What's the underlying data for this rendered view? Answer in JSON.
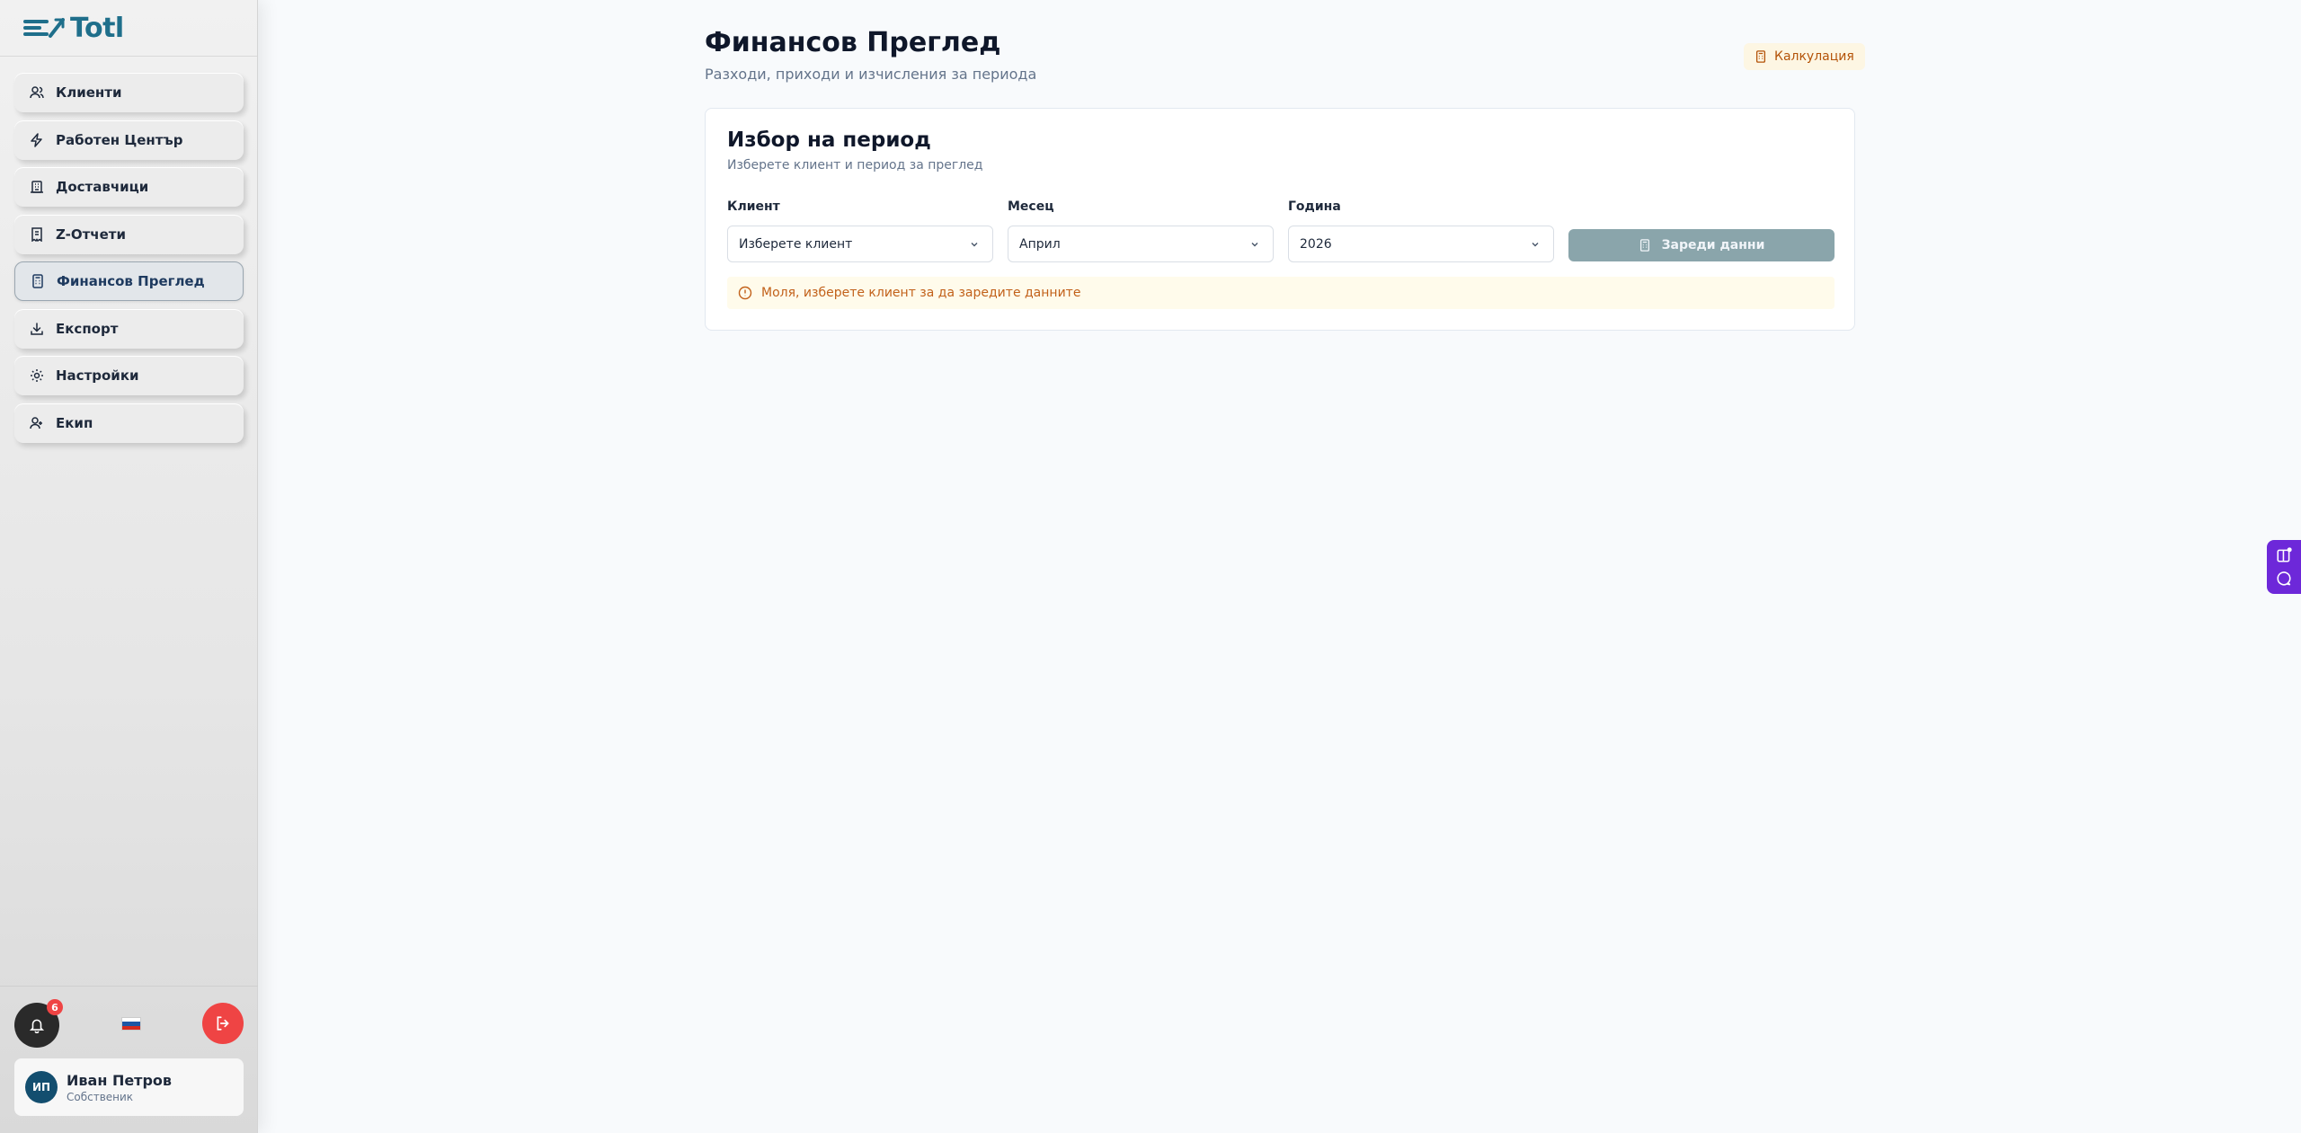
{
  "brand": {
    "name": "Totl",
    "color": "#1f6f8b"
  },
  "sidebar": {
    "items": [
      {
        "label": "Клиенти",
        "icon": "users-icon"
      },
      {
        "label": "Работен Център",
        "icon": "lightning-icon"
      },
      {
        "label": "Доставчици",
        "icon": "building-icon"
      },
      {
        "label": "Z-Отчети",
        "icon": "receipt-icon"
      },
      {
        "label": "Финансов Преглед",
        "icon": "calculator-icon",
        "active": true
      },
      {
        "label": "Експорт",
        "icon": "download-icon"
      },
      {
        "label": "Настройки",
        "icon": "gear-icon"
      },
      {
        "label": "Екип",
        "icon": "team-icon"
      }
    ],
    "notifications_count": "6",
    "user": {
      "initials": "ИП",
      "name": "Иван Петров",
      "role": "Собственик"
    }
  },
  "header": {
    "title": "Финансов Преглед",
    "subtitle": "Разходи, приходи и изчисления за периода",
    "calc_button": "Калкулация"
  },
  "period_card": {
    "title": "Избор на период",
    "subtitle": "Изберете клиент и период за преглед",
    "client": {
      "label": "Клиент",
      "value": "Изберете клиент"
    },
    "month": {
      "label": "Месец",
      "value": "Април"
    },
    "year": {
      "label": "Година",
      "value": "2026"
    },
    "load_button": "Зареди данни",
    "alert": "Моля, изберете клиент за да заредите данните"
  },
  "colors": {
    "accent_disabled": "#8aa5ab",
    "danger": "#ef4444",
    "warning_text": "#c2611a",
    "widget": "#6d28d9"
  }
}
